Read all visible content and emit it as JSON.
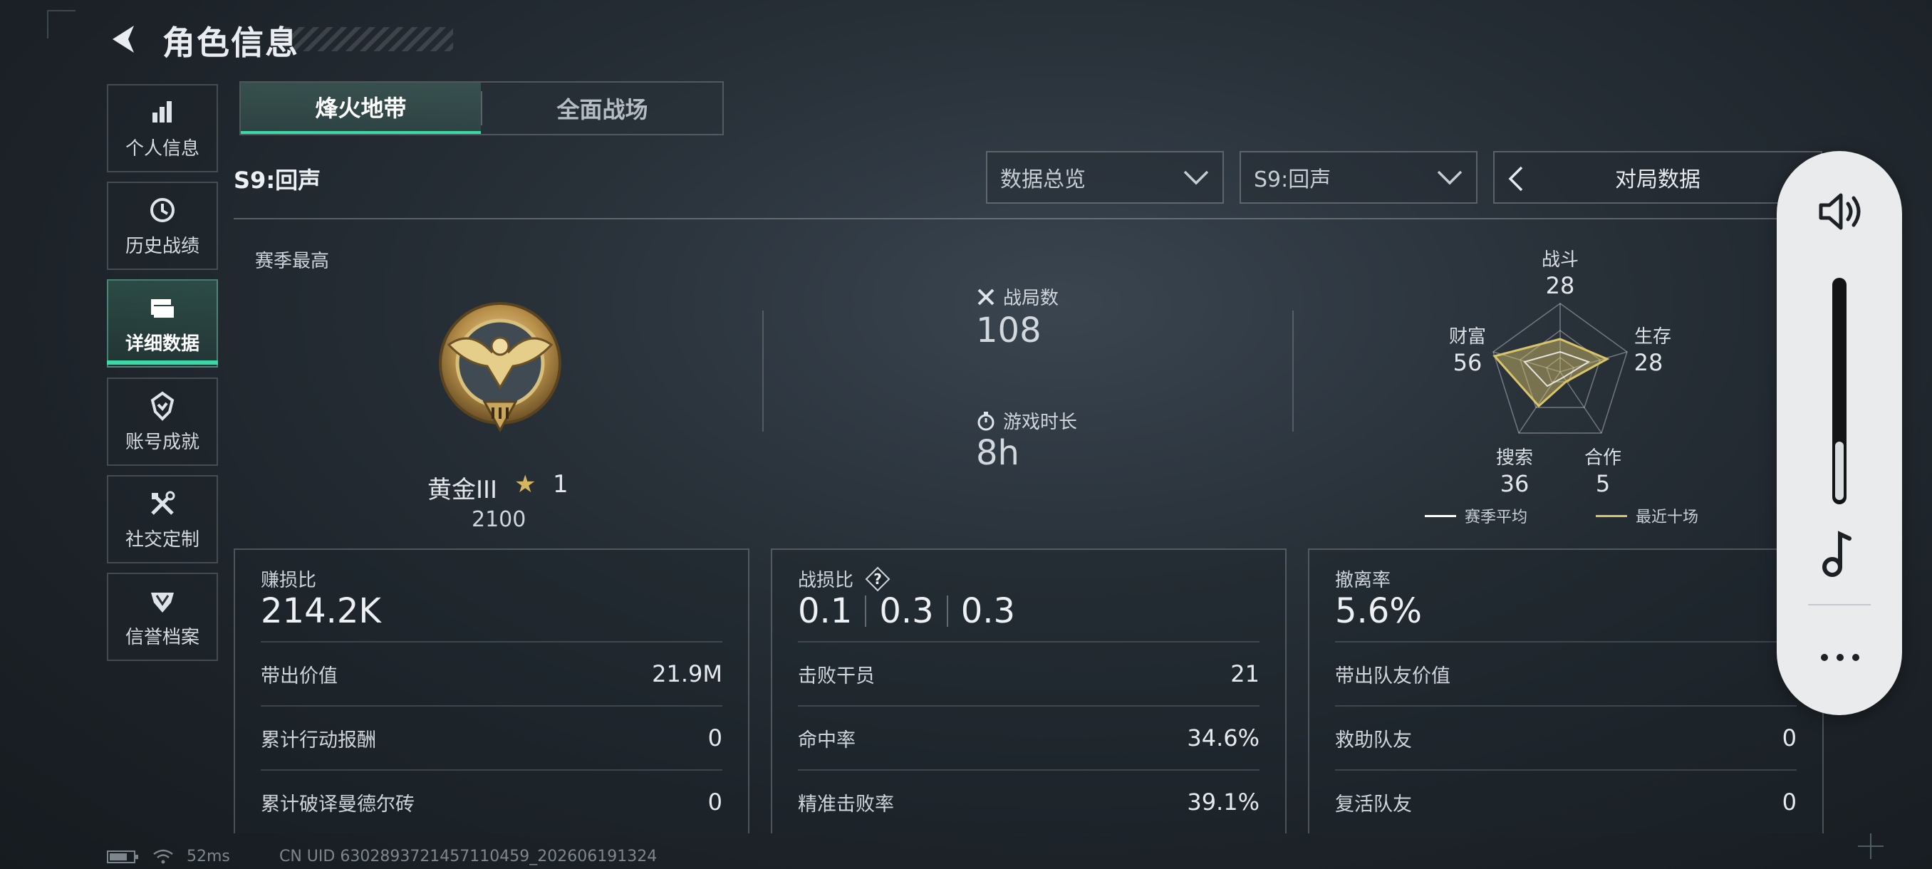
{
  "header": {
    "title": "角色信息"
  },
  "sidebar": {
    "items": [
      {
        "label": "个人信息",
        "icon": "bar-chart-icon"
      },
      {
        "label": "历史战绩",
        "icon": "history-clock-icon"
      },
      {
        "label": "详细数据",
        "icon": "folder-icon",
        "active": true
      },
      {
        "label": "账号成就",
        "icon": "achievement-icon"
      },
      {
        "label": "社交定制",
        "icon": "tools-icon"
      },
      {
        "label": "信誉档案",
        "icon": "credit-badge-icon"
      }
    ]
  },
  "tabs": [
    {
      "label": "烽火地带",
      "active": true
    },
    {
      "label": "全面战场",
      "active": false
    }
  ],
  "season_label": "S9:回声",
  "filters": {
    "data_view": "数据总览",
    "season": "S9:回声",
    "mode": "对局数据"
  },
  "season_best": {
    "label": "赛季最高",
    "rank_name": "黄金III",
    "stars": "1",
    "points": "2100"
  },
  "matches": {
    "label": "战局数",
    "value": "108"
  },
  "playtime": {
    "label": "游戏时长",
    "value": "8h"
  },
  "radar": {
    "axes": [
      {
        "name": "战斗",
        "value": "28"
      },
      {
        "name": "生存",
        "value": "28"
      },
      {
        "name": "合作",
        "value": "5"
      },
      {
        "name": "搜索",
        "value": "36"
      },
      {
        "name": "财富",
        "value": "56"
      }
    ],
    "legend": {
      "season_avg": "赛季平均",
      "recent_ten": "最近十场"
    },
    "colors": {
      "season_avg": "#ffffff",
      "recent_ten": "#d9c46a"
    }
  },
  "panels": {
    "profit": {
      "title": "赚损比",
      "value": "214.2K",
      "rows": [
        {
          "label": "带出价值",
          "value": "21.9M"
        },
        {
          "label": "累计行动报酬",
          "value": "0"
        },
        {
          "label": "累计破译曼德尔砖",
          "value": "0"
        }
      ]
    },
    "combat": {
      "title": "战损比",
      "values": [
        "0.1",
        "0.3",
        "0.3"
      ],
      "rows": [
        {
          "label": "击败干员",
          "value": "21"
        },
        {
          "label": "命中率",
          "value": "34.6%"
        },
        {
          "label": "精准击败率",
          "value": "39.1%"
        }
      ]
    },
    "extract": {
      "title": "撤离率",
      "value": "5.6%",
      "rows": [
        {
          "label": "带出队友价值",
          "value": ""
        },
        {
          "label": "救助队友",
          "value": "0"
        },
        {
          "label": "复活队友",
          "value": "0"
        }
      ]
    }
  },
  "status": {
    "ping": "52ms",
    "uid": "CN UID 6302893721457110459_202606191324"
  },
  "theme": {
    "accent": "#3ad9a6",
    "gold": "#d4b560"
  }
}
